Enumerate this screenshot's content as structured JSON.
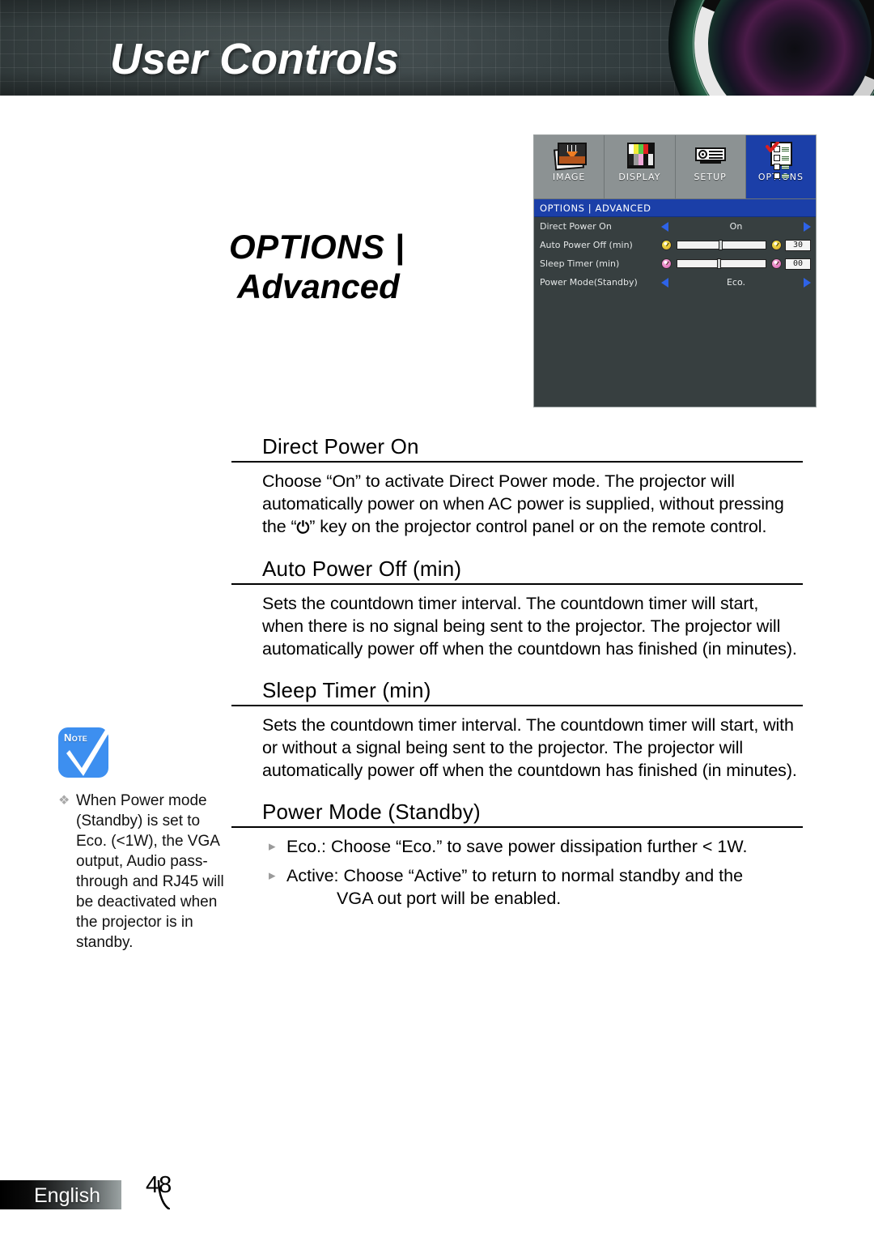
{
  "header": {
    "title": "User Controls",
    "lens_icon": "projector-lens-graphic"
  },
  "page_title": {
    "line1": "OPTIONS |",
    "line2": "Advanced"
  },
  "osd": {
    "tabs": [
      {
        "label": "IMAGE",
        "icon": "image-picture-icon",
        "active": false
      },
      {
        "label": "DISPLAY",
        "icon": "display-colorbars-icon",
        "active": false
      },
      {
        "label": "SETUP",
        "icon": "setup-projector-icon",
        "active": false
      },
      {
        "label": "OPTIONS",
        "icon": "options-checklist-icon",
        "active": true
      }
    ],
    "section_bar": "OPTIONS | ADVANCED",
    "rows": [
      {
        "label": "Direct Power On",
        "type": "arrows",
        "value": "On"
      },
      {
        "label": "Auto Power Off (min)",
        "type": "slider",
        "value": "30",
        "left_icon": "clock-yellow-icon",
        "right_icon": "clock-yellow-icon",
        "knob_percent": 47
      },
      {
        "label": "Sleep Timer (min)",
        "type": "slider",
        "value": "00",
        "left_icon": "clock-pink-icon",
        "right_icon": "clock-pink-icon",
        "knob_percent": 45
      },
      {
        "label": "Power Mode(Standby)",
        "type": "arrows",
        "value": "Eco."
      }
    ],
    "colors": {
      "background": "#373f40",
      "tab_inactive": "#8c9293",
      "tab_active": "#1b3fa8",
      "arrow": "#2e63e8",
      "text": "#e3e6e6"
    }
  },
  "sections": [
    {
      "heading": "Direct Power On",
      "body_part1": "Choose “On” to activate Direct Power mode. The projector will automatically power on when AC power is supplied, without pressing the “",
      "power_glyph": "⏻",
      "body_part2": "” key on the projector control panel or on the remote control."
    },
    {
      "heading": "Auto Power Off (min)",
      "body": "Sets the countdown timer interval. The countdown timer will start, when there is no signal being sent to the projector. The projector will automatically power off when the countdown has finished (in minutes)."
    },
    {
      "heading": "Sleep Timer (min)",
      "body": "Sets the countdown timer interval. The countdown timer will start, with or without a signal being sent to the projector. The projector will automatically power off when the countdown has finished (in minutes)."
    }
  ],
  "power_mode_section": {
    "heading": "Power Mode (Standby)",
    "bullet_mark": "▸",
    "bullets": [
      {
        "text": "Eco.: Choose “Eco.” to save power dissipation further < 1W.",
        "second_line": ""
      },
      {
        "text": "Active: Choose “Active” to return to normal standby and the",
        "second_line": "VGA out port will be enabled."
      }
    ]
  },
  "note": {
    "icon_label": "Note",
    "bullet": "❖",
    "text": "When Power mode (Standby) is set to Eco. (<1W), the VGA output, Audio pass-through and RJ45 will be deactivated when the projector is in standby.",
    "accent_color": "#3d8ff0"
  },
  "footer": {
    "language": "English",
    "page_number": "48"
  }
}
